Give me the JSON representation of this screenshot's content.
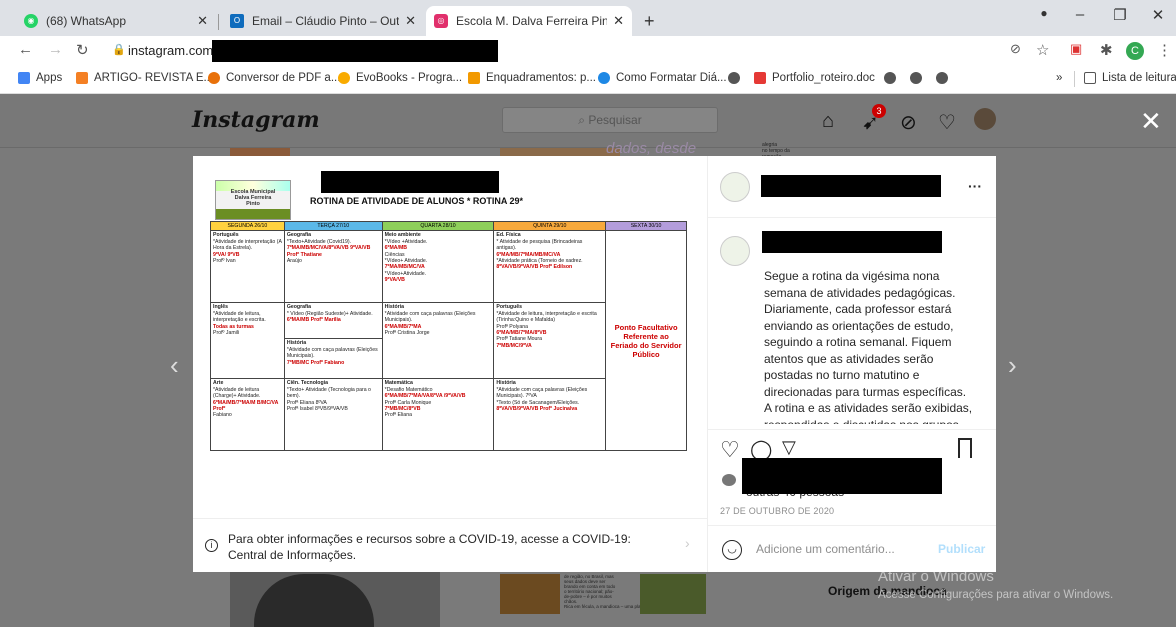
{
  "browser": {
    "tabs": [
      {
        "title": "(68) WhatsApp",
        "color": "#25d366",
        "badge": "68"
      },
      {
        "title": "Email – Cláudio Pinto – Outlook",
        "color": "#0f6cbd"
      },
      {
        "title": "Escola M. Dalva Ferreira Pinto (@",
        "color": "#e1306c"
      }
    ],
    "url": "instagram.com/",
    "new_tab": "+",
    "window": {
      "minimize": "–",
      "maximize": "❐",
      "close": "✕"
    },
    "profile_initial": "C"
  },
  "bookmarks": {
    "items": [
      {
        "label": "Apps",
        "color": "#4285f4"
      },
      {
        "label": "ARTIGO- REVISTA E...",
        "color": "#f48024"
      },
      {
        "label": "Conversor de PDF a...",
        "color": "#e8710a"
      },
      {
        "label": "EvoBooks - Progra...",
        "color": "#f9ab00"
      },
      {
        "label": "Enquadramentos: p...",
        "color": "#f29900"
      },
      {
        "label": "Como Formatar Diá...",
        "color": "#1e88e5"
      },
      {
        "label": "",
        "color": "#555"
      },
      {
        "label": "Portfolio_roteiro.doc",
        "color": "#e53935"
      },
      {
        "label": "",
        "color": "#555"
      },
      {
        "label": "",
        "color": "#555"
      },
      {
        "label": "",
        "color": "#555"
      }
    ],
    "more": "»",
    "reading_list": "Lista de leitura"
  },
  "instagram": {
    "logo": "Instagram",
    "search_placeholder": "Pesquisar",
    "notification_count": "3",
    "bg_text_top": "dados, desde",
    "bg_text_small": "alegria\nno tempo da\nremoção",
    "bg_article_title": "Origem da mandioca",
    "bg_article_text": "de região, no Brasil, mas\nseus dados deve ser\nbrando em conta em todo\no território nacional; pão-\nde-pobre – é por muitos\nchãos.\nRica em fécula, a mandioca – uma planta rústica e nativa do"
  },
  "post": {
    "school_name": "Escola Municipal\nDalva Ferreira\nPinto",
    "title": "ROTINA DE ATIVIDADE DE ALUNOS * ROTINA 29*",
    "days": [
      {
        "label": "SEGUNDA 26/10",
        "color": "#ffd23f"
      },
      {
        "label": "TERÇA 27/10",
        "color": "#5bb8e8"
      },
      {
        "label": "QUARTA 28/10",
        "color": "#8ecf5a"
      },
      {
        "label": "QUINTA 29/10",
        "color": "#f7a93c"
      },
      {
        "label": "SEXTA 30/10",
        "color": "#b39ddb"
      }
    ],
    "cells": {
      "r1c1": "Português\n*Atividade de interpretação (A Hora da Estrela).\n[red]9ºVA/ 9ºVB\nProfº Ivan",
      "r1c2": "Geografia\n*Texto+Atividade (Covid19).\n[red]7ºMA/MB/MC/VA/8ºVA/VB 9ºVA/VB Profª Thatiane\nAraújo",
      "r1c3": "Meio ambiente\n*Vídeo +Atividade.\n[red]6ºMA/MB\nCiências\n*Vídeo+ Atividade.\n[red]7ºMA/MB/MC/VA\n*Vídeo+Atividade.\n[red]9ºVA/VB",
      "r1c4": "Ed. Física\n* Atividade de pesquisa (Brincadeiras antigas).\n[red]6ºMA/MB/7ºMA/MB/MC/VA\n*Atividade prática (Torneio de xadrez.\n[red]8ºVA/VB/9ºVA/VB Profº Edilson",
      "friday": "Ponto Facultativo Referente ao Feriado do Servidor Público",
      "r2c1": "Inglês\n*Atividade de leitura, interpretação e escrita.\n[red]Todas as turmas\nProfº Jamili",
      "r2c2": "Geografia\n* Vídeo (Região Sudeste)+ Atividade.\n[red]6ºMA/MB Profª Marília",
      "r2c2b": "História\n*Atividade com caça palavras (Eleições Municipais).\n[red]7ºMB/MC Profº Fabiano",
      "r2c3": "História\n*Atividade com caça palavras (Eleições Municipais).\n[red]6ºMA/MB/7ºMA\nProfª Cristina Jorge",
      "r2c4": "Português\n*Atividade de leitura, interpretação e escrita (Tirinha:Quino e Mafalda)\nProfª Polyana\n[red]6ºMA/MB/7ºMA/8ºVB\nProfª Tatiane Moura\n[red]7ºMB/MC/9ºVA",
      "r3c1": "Arte\n*Atividade de leitura (Charge)+ Atividade.\n[red]6ºMA/MB/7ºMA/M B/MC/VA Profº\nFabiano",
      "r3c2": "Ciên. Tecnologia\n*Texto+ Atividade (Tecnologia para o bem).\nProfª Eliana 8ºVA\nProfª Isabel 8ºVB/9ºVA/VB",
      "r3c3": "Matemática\n*Desafio Matemático\n[red]6ºMA/MB/7ºMA/VA/8ºVA /9ºVA/VB\nProfª Carla Monique\n[red]7ºMB/MC/8ºVB\nProfª Eliana",
      "r3c4": "História\n*Atividade com caça palavras (Eleições Municipais). 7ºVA\n*Texto (Só de Sacanagem/Eleições.\n[red]8ºVA/VB/9ºVA/VB Profª Jucinalva"
    },
    "covid_notice": "Para obter informações e recursos sobre a COVID-19, acesse a COVID-19: Central de Informações.",
    "more_icon": "···",
    "caption": "Segue a rotina da vigésima nona semana de atividades pedagógicas. Diariamente, cada professor estará enviando as orientações de estudo, seguindo a rotina semanal. Fiquem atentos que as atividades serão postadas no turno matutino e direcionadas para turmas específicas. A rotina e as atividades serão exibidas, respondidas e discutidas nos grupos",
    "likes": "outras 40 pessoas",
    "date": "27 DE OUTUBRO DE 2020",
    "comment_placeholder": "Adicione um comentário...",
    "publish": "Publicar"
  },
  "watermark": {
    "line1": "Ativar o Windows",
    "line2": "Acesse Configurações para ativar o Windows."
  }
}
